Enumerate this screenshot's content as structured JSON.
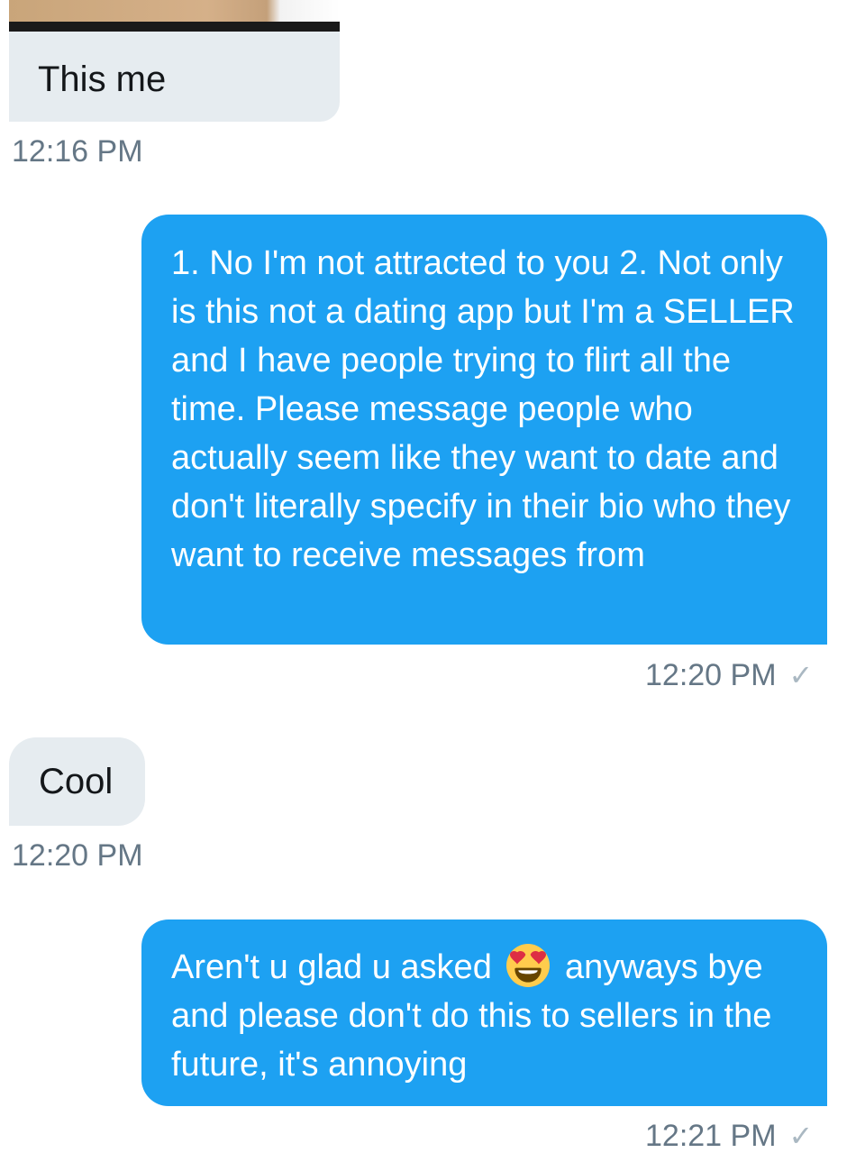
{
  "messages": [
    {
      "direction": "received",
      "type": "image",
      "caption": "This me",
      "time": "12:16 PM"
    },
    {
      "direction": "sent",
      "text": "1. No I'm not attracted to you 2. Not only is this not a dating app but I'm a SELLER and I have people trying to flirt all the time. Please message people who actually seem like they want to date and don't literally specify in their bio who they want to receive messages from",
      "time": "12:20 PM",
      "status_icon": "check-icon"
    },
    {
      "direction": "received",
      "text": "Cool",
      "time": "12:20 PM"
    },
    {
      "direction": "sent",
      "text_before_emoji": "Aren't u glad u asked",
      "emoji": "heart-eyes-emoji",
      "text_after_emoji": "anyways bye and please don't do this to sellers in the future, it's annoying",
      "time": "12:21 PM",
      "status_icon": "check-icon"
    }
  ],
  "colors": {
    "sent_bubble": "#1da1f2",
    "received_bubble": "#e6ecf0",
    "timestamp": "#657786",
    "check": "#aab8c2"
  }
}
